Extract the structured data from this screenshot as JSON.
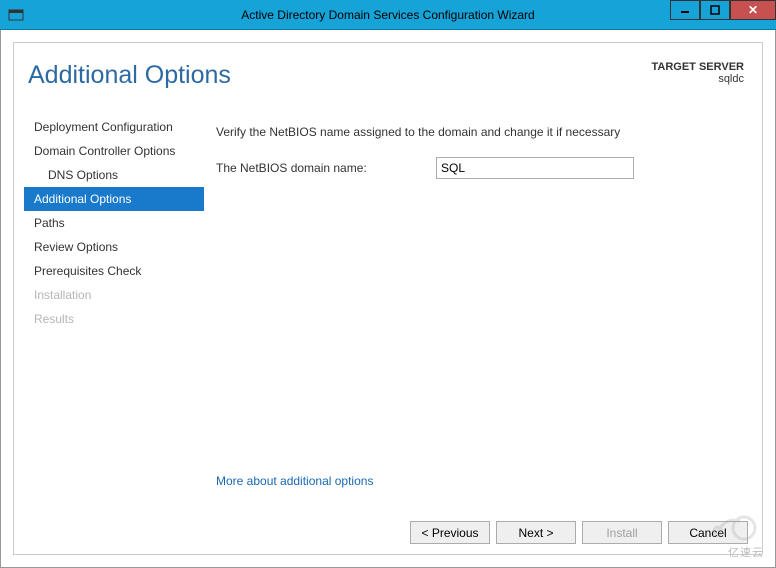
{
  "window": {
    "title": "Active Directory Domain Services Configuration Wizard"
  },
  "heading": "Additional Options",
  "target": {
    "label": "TARGET SERVER",
    "value": "sqldc"
  },
  "nav": {
    "items": [
      {
        "label": "Deployment Configuration",
        "state": "normal"
      },
      {
        "label": "Domain Controller Options",
        "state": "normal"
      },
      {
        "label": "DNS Options",
        "state": "normal",
        "sub": true
      },
      {
        "label": "Additional Options",
        "state": "active"
      },
      {
        "label": "Paths",
        "state": "normal"
      },
      {
        "label": "Review Options",
        "state": "normal"
      },
      {
        "label": "Prerequisites Check",
        "state": "normal"
      },
      {
        "label": "Installation",
        "state": "disabled"
      },
      {
        "label": "Results",
        "state": "disabled"
      }
    ]
  },
  "content": {
    "instruction": "Verify the NetBIOS name assigned to the domain and change it if necessary",
    "netbios_label": "The NetBIOS domain name:",
    "netbios_value": "SQL",
    "more_link": "More about additional options"
  },
  "footer": {
    "previous": "< Previous",
    "next": "Next >",
    "install": "Install",
    "cancel": "Cancel"
  },
  "watermark_text": "亿速云"
}
